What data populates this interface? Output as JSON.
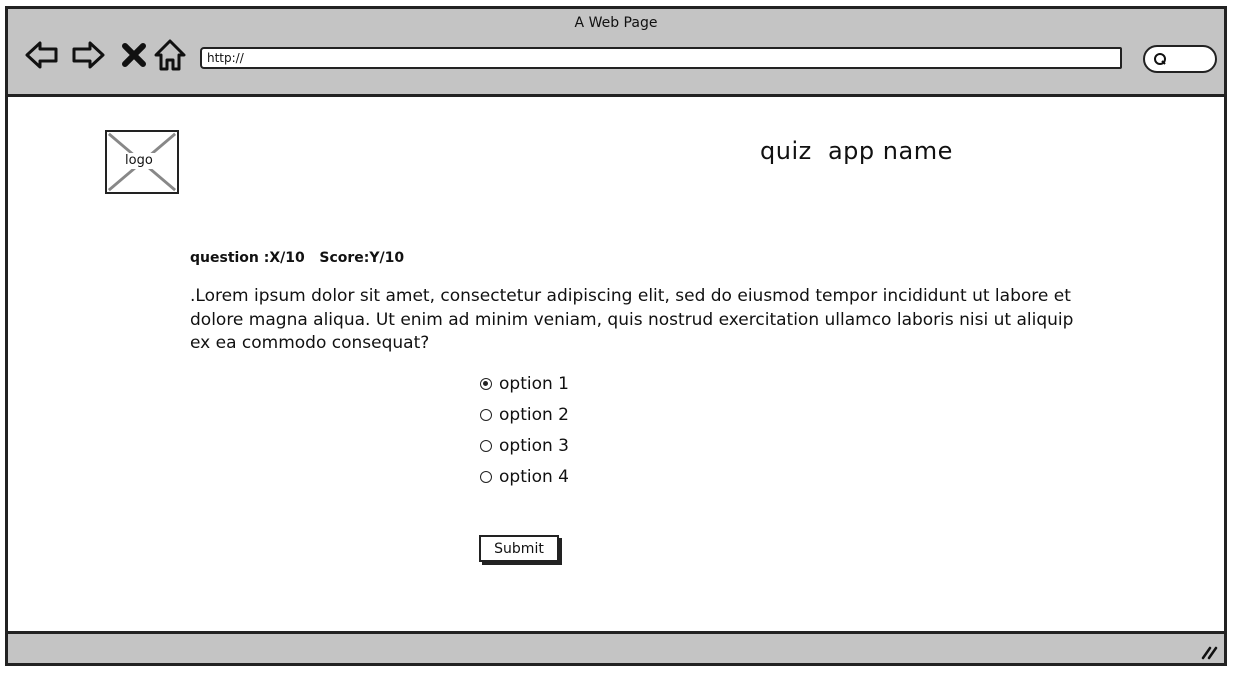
{
  "browser": {
    "title": "A Web Page",
    "url": "http://",
    "icons": {
      "back": "back-arrow-icon",
      "forward": "forward-arrow-icon",
      "stop": "close-icon",
      "home": "home-icon",
      "search": "search-icon",
      "resize": "resize-grip-icon"
    }
  },
  "header": {
    "logo_label": "logo",
    "app_name": "quiz  app name"
  },
  "quiz": {
    "status": "question :X/10   Score:Y/10",
    "question_text": ".Lorem ipsum dolor sit amet, consectetur adipiscing elit, sed do eiusmod tempor incididunt ut labore et dolore magna aliqua. Ut enim ad minim veniam, quis nostrud exercitation ullamco laboris nisi ut aliquip ex ea commodo consequat?",
    "options": [
      {
        "label": "option 1",
        "selected": true
      },
      {
        "label": "option 2",
        "selected": false
      },
      {
        "label": "option 3",
        "selected": false
      },
      {
        "label": "option 4",
        "selected": false
      }
    ],
    "submit_label": "Submit"
  }
}
